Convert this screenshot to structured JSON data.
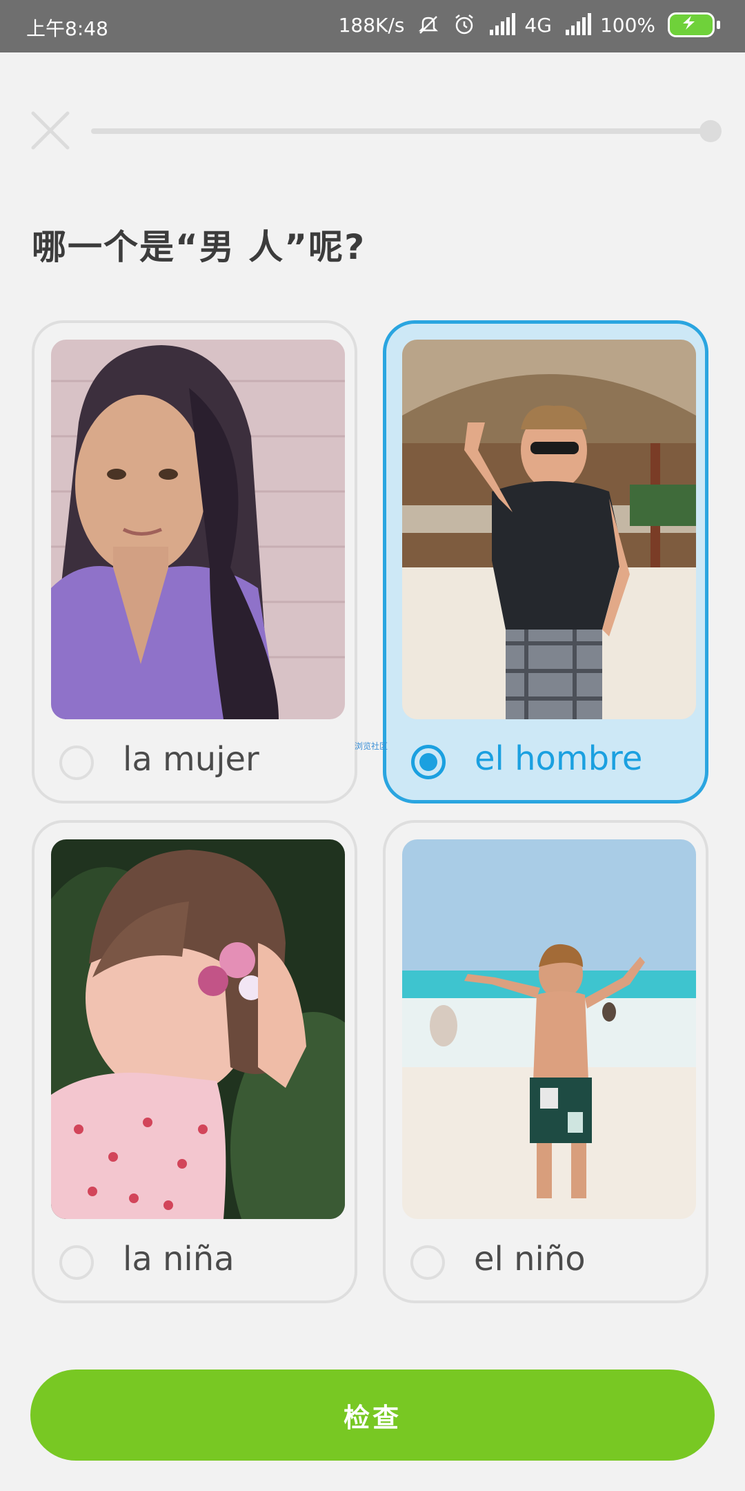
{
  "status_bar": {
    "time": "上午8:48",
    "network_speed": "188K/s",
    "network_type": "4G",
    "battery": "100%"
  },
  "header": {
    "close_icon": "close-icon",
    "progress": 1.0
  },
  "question": {
    "text": "哪一个是“男 人”呢?"
  },
  "options": [
    {
      "label": "la mujer",
      "selected": false,
      "image": "woman-photo"
    },
    {
      "label": "el hombre",
      "selected": true,
      "image": "man-photo"
    },
    {
      "label": "la niña",
      "selected": false,
      "image": "girl-photo"
    },
    {
      "label": "el niño",
      "selected": false,
      "image": "boy-photo"
    }
  ],
  "watermark": "浏览社区",
  "footer": {
    "check_label": "检查"
  },
  "colors": {
    "accent_blue": "#1ba0e0",
    "selected_bg": "#cde8f6",
    "button_green": "#78c823",
    "background": "#f2f2f2"
  }
}
